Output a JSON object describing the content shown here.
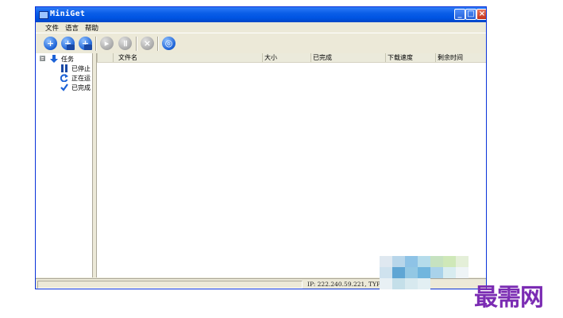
{
  "window": {
    "title": "MiniGet",
    "controls": {
      "minimize": "_",
      "maximize": "□",
      "close": "×"
    }
  },
  "menu": [
    "文件",
    "语言",
    "帮助"
  ],
  "toolbar": {
    "buttons": [
      {
        "icon": "add-icon",
        "style": "blue",
        "symbol": "+"
      },
      {
        "icon": "add-batch-icon",
        "style": "blue",
        "symbol": "+"
      },
      {
        "icon": "add-from-clipboard-icon",
        "style": "blue",
        "symbol": "+"
      },
      {
        "icon": "start-icon",
        "style": "gray",
        "symbol": "▸"
      },
      {
        "icon": "pause-icon",
        "style": "gray",
        "symbol": "॥"
      },
      {
        "icon": "delete-icon",
        "style": "gray",
        "symbol": "×"
      },
      {
        "icon": "settings-icon",
        "style": "blue",
        "symbol": "◎"
      }
    ]
  },
  "tree": {
    "root": {
      "label": "任务",
      "expander": "⊟",
      "icon": "down-arrow-icon"
    },
    "children": [
      {
        "label": "已停止",
        "icon": "pause-bars-icon"
      },
      {
        "label": "正在运",
        "icon": "refresh-icon"
      },
      {
        "label": "已完成",
        "icon": "checkmark-icon"
      }
    ]
  },
  "columns": [
    "文件名",
    "大小",
    "已完成",
    "下载速度",
    "剩余时间"
  ],
  "statusbar": {
    "ip_text": "IP: 222.240.59.221, TYPE"
  },
  "watermark": "最需网",
  "colors": {
    "titlebar": "#0054e3",
    "accent_blue": "#1c62d6",
    "watermark": "#7b2cb3"
  }
}
